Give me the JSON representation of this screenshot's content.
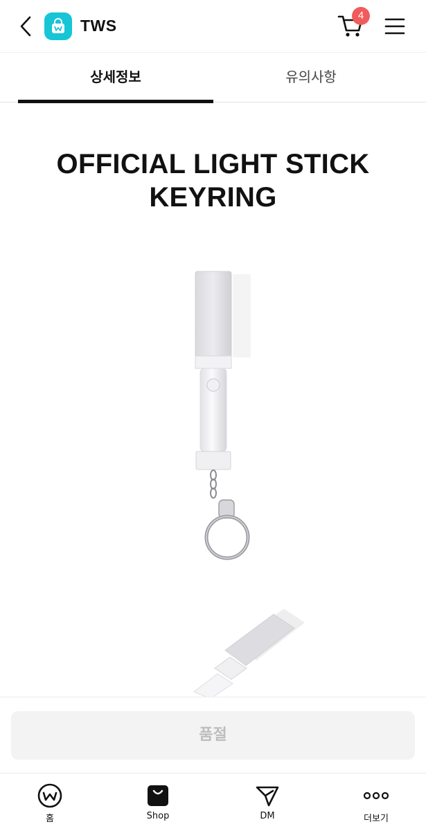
{
  "header": {
    "title": "TWS",
    "cart_count": "4",
    "icons": {
      "back": "chevron-left-icon",
      "logo": "weverse-shop-bag-icon",
      "cart": "cart-icon",
      "menu": "hamburger-menu-icon"
    }
  },
  "tabs": [
    {
      "label": "상세정보",
      "active": true
    },
    {
      "label": "유의사항",
      "active": false
    }
  ],
  "product": {
    "title_line1": "OFFICIAL LIGHT STICK",
    "title_line2": "KEYRING"
  },
  "purchase": {
    "button_label": "품절"
  },
  "bottom_nav": {
    "items": [
      {
        "label": "홈",
        "icon": "weverse-home-icon"
      },
      {
        "label": "Shop",
        "icon": "shopping-bag-icon"
      },
      {
        "label": "DM",
        "icon": "paper-plane-icon"
      },
      {
        "label": "더보기",
        "icon": "more-dots-icon"
      }
    ]
  },
  "colors": {
    "brand_teal": "#16c5d6",
    "badge_red": "#f15b5b",
    "disabled_button_bg": "#f3f3f3",
    "disabled_button_text": "#bdbdbd"
  }
}
